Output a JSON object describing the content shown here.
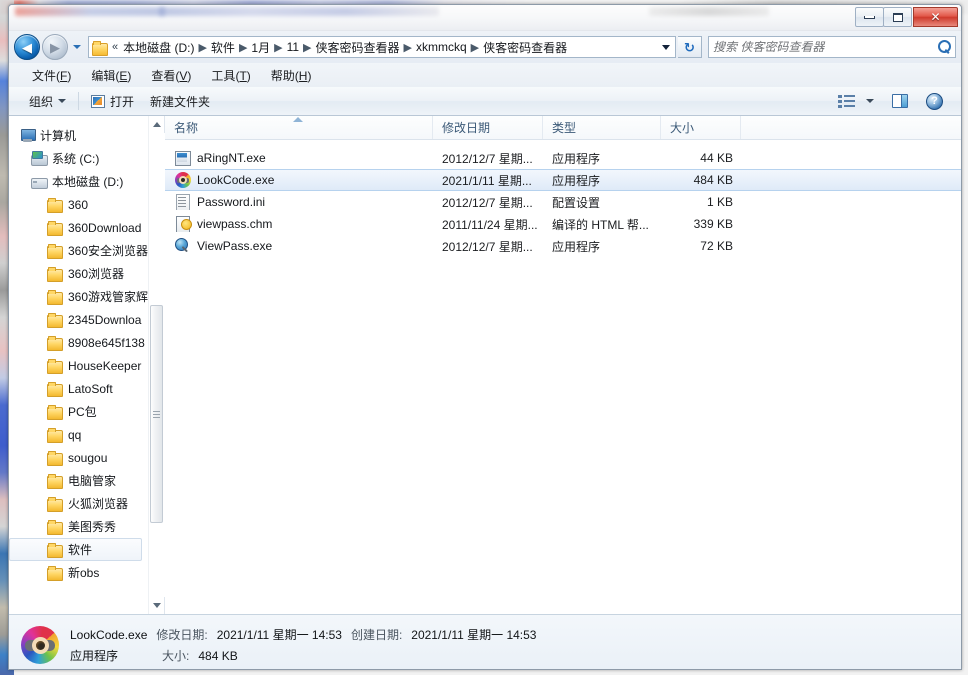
{
  "window": {
    "controls": {
      "minimize_label": "最小化",
      "maximize_label": "还原",
      "close_label": "✕"
    }
  },
  "address": {
    "back_label": "◀",
    "forward_label": "▶",
    "history_label": "历史记录",
    "overflow": "«",
    "breadcrumb": [
      "本地磁盘 (D:)",
      "软件",
      "1月",
      "11",
      "侠客密码查看器",
      "xkmmckq",
      "侠客密码查看器"
    ],
    "separator": "▶",
    "refresh_label": "↻",
    "search_placeholder": "搜索 侠客密码查看器",
    "search_value": ""
  },
  "menubar": {
    "items": [
      {
        "text": "文件",
        "key": "F"
      },
      {
        "text": "编辑",
        "key": "E"
      },
      {
        "text": "查看",
        "key": "V"
      },
      {
        "text": "工具",
        "key": "T"
      },
      {
        "text": "帮助",
        "key": "H"
      }
    ]
  },
  "commandbar": {
    "organize_label": "组织",
    "open_label": "打开",
    "newfolder_label": "新建文件夹",
    "view_icon": "view-list-icon",
    "pane_icon": "preview-pane-icon",
    "help_icon": "help-icon",
    "help_glyph": "?"
  },
  "navpane": {
    "items": [
      {
        "label": "计算机",
        "icon": "computer-icon",
        "level": 0,
        "selected": false
      },
      {
        "label": "系统 (C:)",
        "icon": "drive-system-icon",
        "level": 1,
        "selected": false
      },
      {
        "label": "本地磁盘 (D:)",
        "icon": "drive-icon",
        "level": 1,
        "selected": false
      },
      {
        "label": "360",
        "icon": "folder-icon",
        "level": 2,
        "selected": false
      },
      {
        "label": "360Download",
        "icon": "folder-icon",
        "level": 2,
        "selected": false
      },
      {
        "label": "360安全浏览器",
        "icon": "folder-icon",
        "level": 2,
        "selected": false
      },
      {
        "label": "360浏览器",
        "icon": "folder-icon",
        "level": 2,
        "selected": false
      },
      {
        "label": "360游戏管家辉",
        "icon": "folder-icon",
        "level": 2,
        "selected": false
      },
      {
        "label": "2345Downloa",
        "icon": "folder-icon",
        "level": 2,
        "selected": false
      },
      {
        "label": "8908e645f138",
        "icon": "folder-icon",
        "level": 2,
        "selected": false
      },
      {
        "label": "HouseKeeper",
        "icon": "folder-icon",
        "level": 2,
        "selected": false
      },
      {
        "label": "LatoSoft",
        "icon": "folder-icon",
        "level": 2,
        "selected": false
      },
      {
        "label": "PC包",
        "icon": "folder-icon",
        "level": 2,
        "selected": false
      },
      {
        "label": "qq",
        "icon": "folder-icon",
        "level": 2,
        "selected": false
      },
      {
        "label": "sougou",
        "icon": "folder-icon",
        "level": 2,
        "selected": false
      },
      {
        "label": "电脑管家",
        "icon": "folder-icon",
        "level": 2,
        "selected": false
      },
      {
        "label": "火狐浏览器",
        "icon": "folder-icon",
        "level": 2,
        "selected": false
      },
      {
        "label": "美图秀秀",
        "icon": "folder-icon",
        "level": 2,
        "selected": false
      },
      {
        "label": "软件",
        "icon": "folder-icon",
        "level": 2,
        "selected": true
      },
      {
        "label": "新obs",
        "icon": "folder-icon",
        "level": 2,
        "selected": false
      }
    ]
  },
  "filelist": {
    "columns": [
      {
        "label": "名称",
        "key": "name"
      },
      {
        "label": "修改日期",
        "key": "date"
      },
      {
        "label": "类型",
        "key": "type"
      },
      {
        "label": "大小",
        "key": "size"
      }
    ],
    "sort_column": "名称",
    "sort_direction": "asc",
    "rows": [
      {
        "name": "aRingNT.exe",
        "date": "2012/12/7 星期...",
        "type": "应用程序",
        "size": "44 KB",
        "icon": "app-window-icon",
        "selected": false
      },
      {
        "name": "LookCode.exe",
        "date": "2021/1/11 星期...",
        "type": "应用程序",
        "size": "484 KB",
        "icon": "colorful-eye-icon",
        "selected": true
      },
      {
        "name": "Password.ini",
        "date": "2012/12/7 星期...",
        "type": "配置设置",
        "size": "1 KB",
        "icon": "ini-file-icon",
        "selected": false
      },
      {
        "name": "viewpass.chm",
        "date": "2011/11/24 星期...",
        "type": "编译的 HTML 帮...",
        "size": "339 KB",
        "icon": "chm-help-icon",
        "selected": false
      },
      {
        "name": "ViewPass.exe",
        "date": "2012/12/7 星期...",
        "type": "应用程序",
        "size": "72 KB",
        "icon": "magnifier-globe-icon",
        "selected": false
      }
    ]
  },
  "statusbar": {
    "icon": "colorful-eye-icon",
    "filename": "LookCode.exe",
    "modified_label": "修改日期:",
    "modified_value": "2021/1/11 星期一 14:53",
    "created_label": "创建日期:",
    "created_value": "2021/1/11 星期一 14:53",
    "type_value": "应用程序",
    "size_label": "大小:",
    "size_value": "484 KB"
  }
}
